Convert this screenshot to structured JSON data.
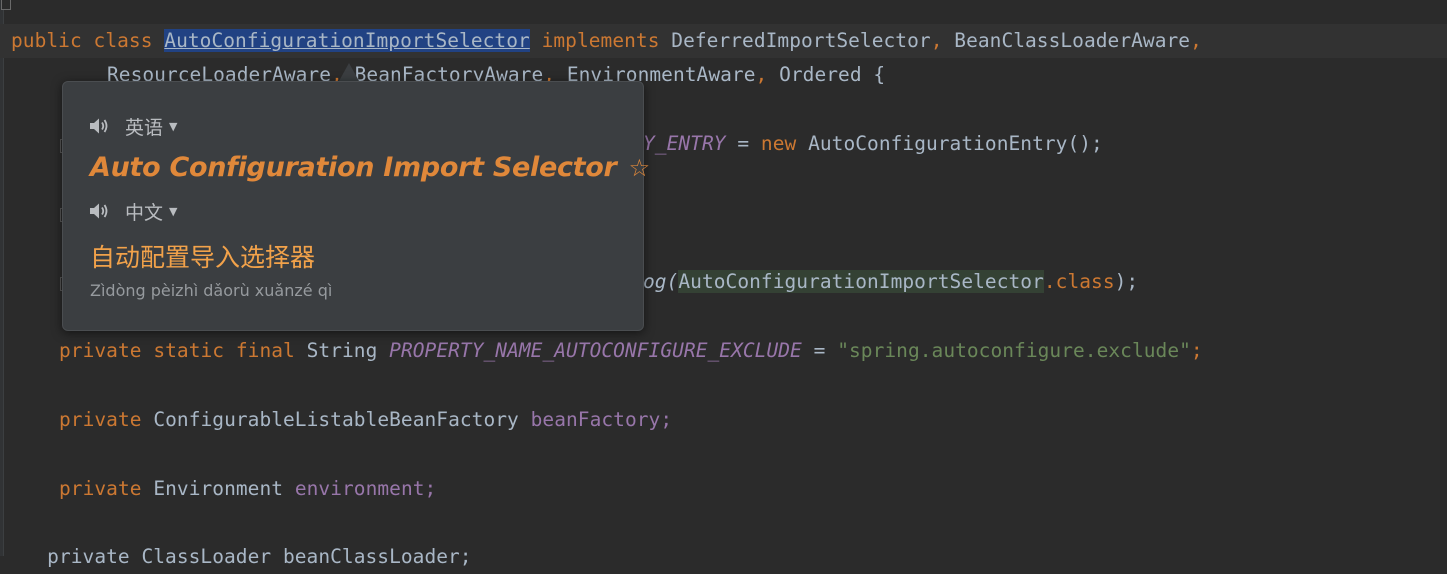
{
  "editor": {
    "comment_close": " */",
    "line_class": {
      "kw_public": "public",
      "kw_class": "class",
      "class_name": "AutoConfigurationImportSelector",
      "kw_implements": "implements",
      "iface1": "DeferredImportSelector",
      "iface2": "BeanClassLoaderAware"
    },
    "line_ifaces": {
      "a": "ResourceLoaderAware",
      "b": "BeanFactoryAware",
      "c": "EnvironmentAware",
      "d": "Ordered {"
    },
    "line_entry": {
      "field": "Y_ENTRY",
      "kw_new": "new",
      "ctor": "AutoConfigurationEntry();"
    },
    "line_log": {
      "method": "og(",
      "arg": "AutoConfigurationImportSelector",
      "kw_class": ".class",
      "end": ");"
    },
    "line_prop": {
      "kw1": "private",
      "kw2": "static",
      "kw3": "final",
      "type": "String",
      "name": "PROPERTY_NAME_AUTOCONFIGURE_EXCLUDE",
      "eq": " = ",
      "value": "\"spring.autoconfigure.exclude\"",
      "semi": ";"
    },
    "line_bf": {
      "kw": "private",
      "type": "ConfigurableListableBeanFactory",
      "name": "beanFactory;"
    },
    "line_env": {
      "kw": "private",
      "type": "Environment",
      "name": "environment;"
    },
    "line_partial": "    private ClassLoader beanClassLoader;"
  },
  "popup": {
    "source_lang": "英语",
    "source_text": "Auto Configuration Import Selector",
    "star_icon": "☆",
    "target_lang": "中文",
    "target_text": "自动配置导入选择器",
    "pinyin": "Zìdòng pèizhì dǎorù xuǎnzé qì"
  },
  "colors": {
    "background": "#2b2b2b",
    "keyword": "#cc7832",
    "string": "#6a8759",
    "field": "#9876aa",
    "selection": "#214283",
    "popup_bg": "#3b3e41",
    "accent_orange": "#e0883a"
  }
}
